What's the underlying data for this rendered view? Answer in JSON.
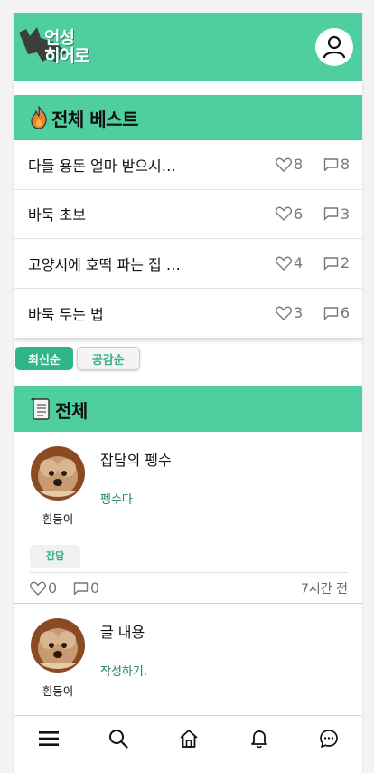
{
  "header": {
    "logo_text_line1": "언성",
    "logo_text_line2": "히어로"
  },
  "best": {
    "title": "전체 베스트",
    "items": [
      {
        "title": "다들 용돈 얼마 받으시…",
        "likes": "8",
        "comments": "8"
      },
      {
        "title": "바둑 초보",
        "likes": "6",
        "comments": "3"
      },
      {
        "title": "고양시에 호떡 파는 집 …",
        "likes": "4",
        "comments": "2"
      },
      {
        "title": "바둑 두는 법",
        "likes": "3",
        "comments": "6"
      }
    ]
  },
  "sort": {
    "latest": "최신순",
    "empathy": "공감순"
  },
  "all": {
    "title": "전체",
    "posts": [
      {
        "title": "잡담의 펭수",
        "excerpt": "펭수다",
        "author": "흰둥이",
        "tag": "잡담",
        "likes": "0",
        "comments": "0",
        "time": "7시간 전"
      },
      {
        "title": "글 내용",
        "excerpt": "작성하기.",
        "author": "흰둥이"
      }
    ]
  },
  "icons": {
    "logo": "bat-icon",
    "profile": "user-icon",
    "best": "fire-icon",
    "all": "scroll-icon",
    "like": "heart-icon",
    "comment": "comment-icon",
    "nav": [
      "menu-icon",
      "search-icon",
      "home-icon",
      "bell-icon",
      "chat-icon"
    ]
  },
  "colors": {
    "accent": "#4fcfa0",
    "accent_dark": "#2fb589"
  }
}
